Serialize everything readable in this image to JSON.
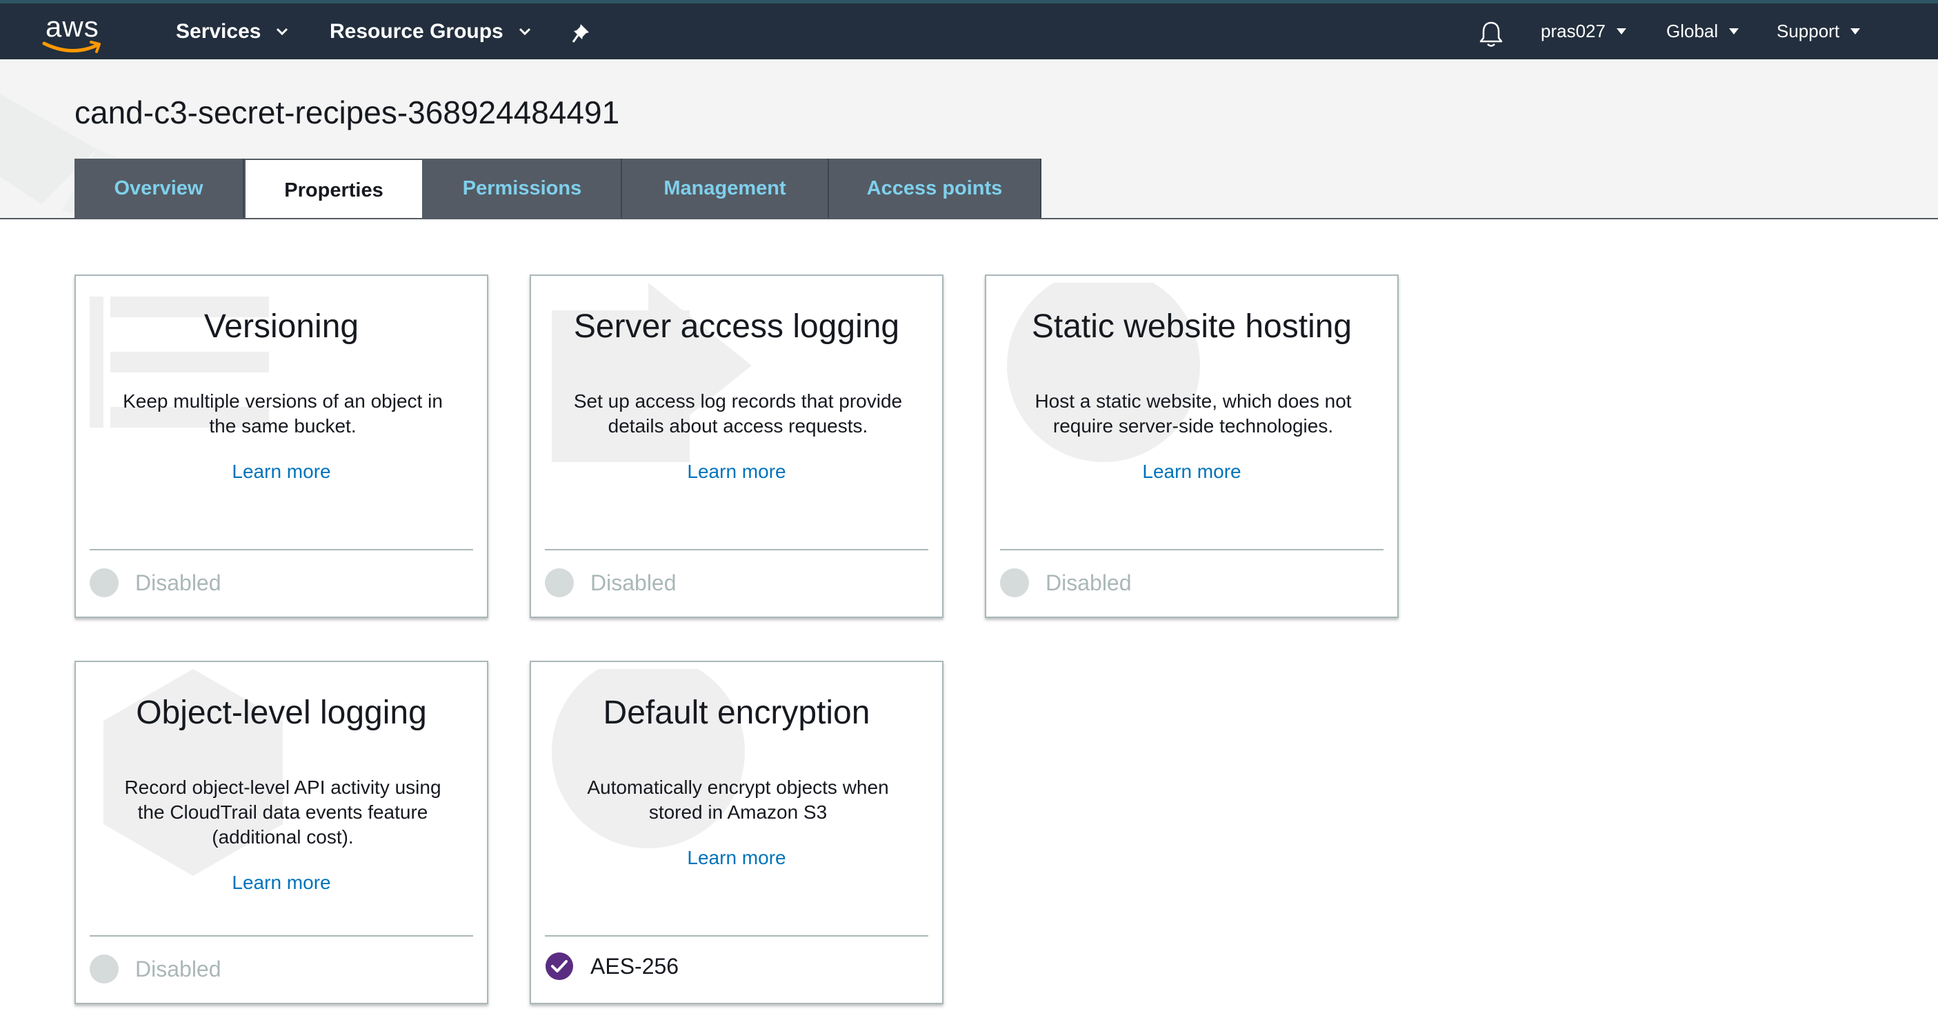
{
  "navbar": {
    "logo_text": "aws",
    "services_label": "Services",
    "resource_groups_label": "Resource Groups",
    "pin_icon": "pin-icon",
    "bell_icon": "bell-icon",
    "user_label": "pras027",
    "region_label": "Global",
    "support_label": "Support",
    "colors": {
      "bar": "#232f3e",
      "smile": "#ff9900"
    }
  },
  "header": {
    "bucket_name": "cand-c3-secret-recipes-368924484491",
    "tabs": [
      {
        "label": "Overview",
        "active": false
      },
      {
        "label": "Properties",
        "active": true
      },
      {
        "label": "Permissions",
        "active": false
      },
      {
        "label": "Management",
        "active": false
      },
      {
        "label": "Access points",
        "active": false
      }
    ]
  },
  "cards": [
    {
      "title": "Versioning",
      "description": "Keep multiple versions of an object in the same bucket.",
      "link": "Learn more",
      "status": "Disabled",
      "enabled": false
    },
    {
      "title": "Server access logging",
      "description": "Set up access log records that provide details about access requests.",
      "link": "Learn more",
      "status": "Disabled",
      "enabled": false
    },
    {
      "title": "Static website hosting",
      "description": "Host a static website, which does not require server-side technologies.",
      "link": "Learn more",
      "status": "Disabled",
      "enabled": false
    },
    {
      "title": "Object-level logging",
      "description": "Record object-level API activity using the CloudTrail data events feature (additional cost).",
      "link": "Learn more",
      "status": "Disabled",
      "enabled": false
    },
    {
      "title": "Default encryption",
      "description": "Automatically encrypt objects when stored in Amazon S3",
      "link": "Learn more",
      "status": "AES-256",
      "enabled": true
    }
  ],
  "colors": {
    "link": "#0073bb",
    "tab_text": "#7fd0ec",
    "enabled_check": "#5a2d82"
  }
}
